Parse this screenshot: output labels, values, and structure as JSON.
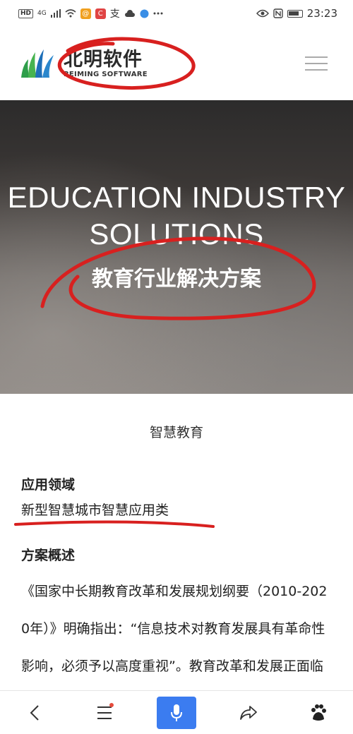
{
  "status_bar": {
    "network_badge": "HD",
    "signal_label": "4G",
    "time": "23:23",
    "app_badge_orange": "@",
    "app_badge_red": "C",
    "app_text": "支"
  },
  "header": {
    "logo_cn": "北明软件",
    "logo_en": "BEIMING SOFTWARE"
  },
  "hero": {
    "title": "EDUCATION INDUSTRY SOLUTIONS",
    "subtitle": "教育行业解决方案"
  },
  "content": {
    "section_title": "智慧教育",
    "field_label": "应用领域",
    "field_value": "新型智慧城市智慧应用类",
    "overview_label": "方案概述",
    "overview_text": "《国家中长期教育改革和发展规划纲要（2010-2020年）》明确指出：“信息技术对教育发展具有革命性影响，必须予以高度重视”。教育改革和发展正面临着前所未有的"
  },
  "colors": {
    "annotation_red": "#d8201f",
    "mic_blue": "#3b7cf0",
    "logo_green": "#2e9e4a",
    "logo_blue": "#1e6fb8"
  },
  "toolbar": {
    "icons": [
      "back-icon",
      "menu-icon",
      "mic-icon",
      "share-icon",
      "baidu-paw-icon"
    ]
  }
}
